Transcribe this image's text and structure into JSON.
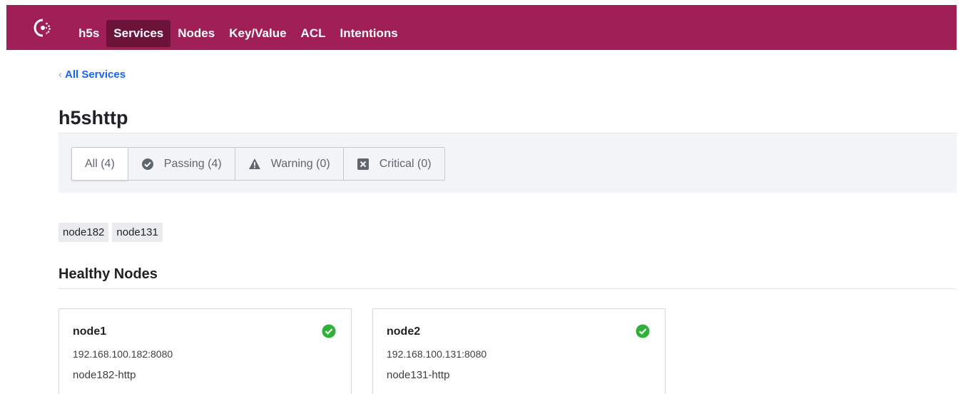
{
  "nav": {
    "logo_icon": "consul-logo-icon",
    "items": [
      {
        "label": "h5s",
        "active": false
      },
      {
        "label": "Services",
        "active": true
      },
      {
        "label": "Nodes",
        "active": false
      },
      {
        "label": "Key/Value",
        "active": false
      },
      {
        "label": "ACL",
        "active": false
      },
      {
        "label": "Intentions",
        "active": false
      }
    ]
  },
  "breadcrumb": {
    "chevron": "‹",
    "label": "All Services"
  },
  "page": {
    "title": "h5shttp"
  },
  "filters": [
    {
      "label": "All (4)",
      "icon": "",
      "selected": true
    },
    {
      "label": "Passing (4)",
      "icon": "check-circle-icon",
      "selected": false
    },
    {
      "label": "Warning (0)",
      "icon": "warning-icon",
      "selected": false
    },
    {
      "label": "Critical (0)",
      "icon": "critical-x-icon",
      "selected": false
    }
  ],
  "tags": [
    "node182",
    "node131"
  ],
  "section": {
    "title": "Healthy Nodes"
  },
  "nodes": [
    {
      "name": "node1",
      "address": "192.168.100.182:8080",
      "service": "node182-http",
      "status_icon": "check-circle-icon",
      "status": "passing"
    },
    {
      "name": "node2",
      "address": "192.168.100.131:8080",
      "service": "node131-http",
      "status_icon": "check-circle-icon",
      "status": "passing"
    }
  ],
  "colors": {
    "header": "#a01f56",
    "active_nav": "#6b1339",
    "link": "#1563ff",
    "passing": "#2eb039",
    "icon_gray": "#5f6670"
  }
}
